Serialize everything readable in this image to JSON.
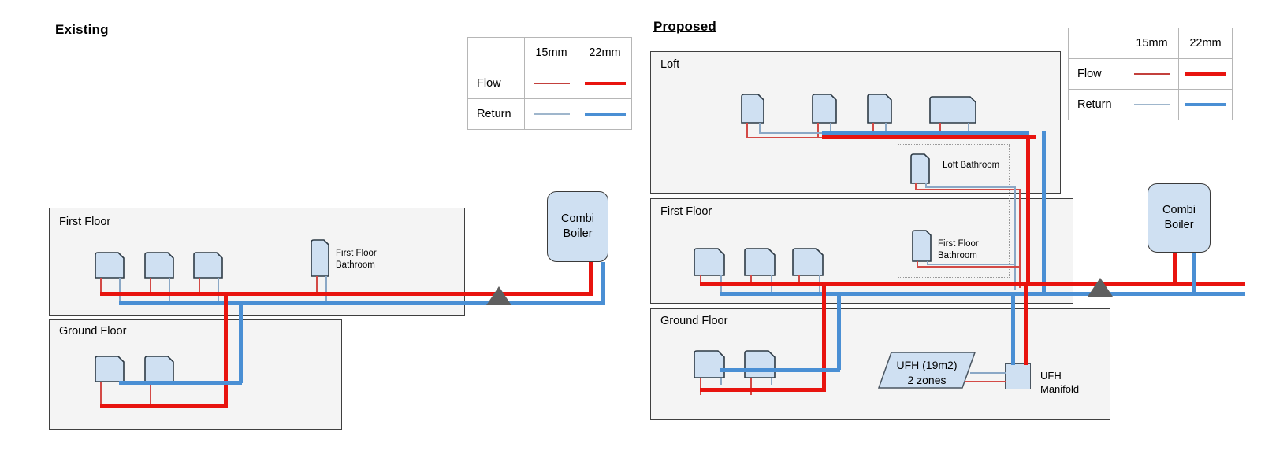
{
  "diagram": {
    "sections": [
      {
        "key": "existing",
        "title": "Existing"
      },
      {
        "key": "proposed",
        "title": "Proposed"
      }
    ]
  },
  "legend": {
    "corner_label": "",
    "columns": [
      "15mm",
      "22mm"
    ],
    "rows": [
      {
        "label": "Flow",
        "thin_color": "#c3403c",
        "thick_color": "#e8140f"
      },
      {
        "label": "Return",
        "thin_color": "#9fb6cc",
        "thick_color": "#4a8fd4"
      }
    ]
  },
  "existing": {
    "title": "Existing",
    "floors": [
      {
        "key": "first",
        "label": "First Floor"
      },
      {
        "key": "ground",
        "label": "Ground Floor"
      }
    ],
    "first_floor": {
      "label": "First Floor",
      "radiator_count": 3,
      "bathroom_radiator_label": "First Floor\nBathroom"
    },
    "ground_floor": {
      "label": "Ground Floor",
      "radiator_count": 2
    },
    "boiler": {
      "label": "Combi\nBoiler"
    }
  },
  "proposed": {
    "title": "Proposed",
    "floors": [
      {
        "key": "loft",
        "label": "Loft"
      },
      {
        "key": "first",
        "label": "First Floor"
      },
      {
        "key": "ground",
        "label": "Ground Floor"
      }
    ],
    "loft": {
      "label": "Loft",
      "radiator_count": 4,
      "bathroom_label": "Loft Bathroom"
    },
    "first_floor": {
      "label": "First Floor",
      "radiator_count": 3,
      "bathroom_label": "First Floor\nBathroom"
    },
    "ground_floor": {
      "label": "Ground Floor",
      "radiator_count": 2,
      "ufh_label": "UFH (19m2)\n2 zones",
      "manifold_label": "UFH\nManifold"
    },
    "boiler": {
      "label": "Combi\nBoiler"
    }
  },
  "colors": {
    "flow_22mm": "#e8140f",
    "return_22mm": "#4a8fd4",
    "flow_15mm": "#c3403c",
    "return_15mm": "#9fb6cc",
    "radiator_fill": "#cfe0f2",
    "radiator_stroke": "#2d3a45",
    "floor_fill": "#f4f4f4",
    "floor_stroke": "#3f3f3f",
    "marker_gray": "#5f5f5f"
  }
}
